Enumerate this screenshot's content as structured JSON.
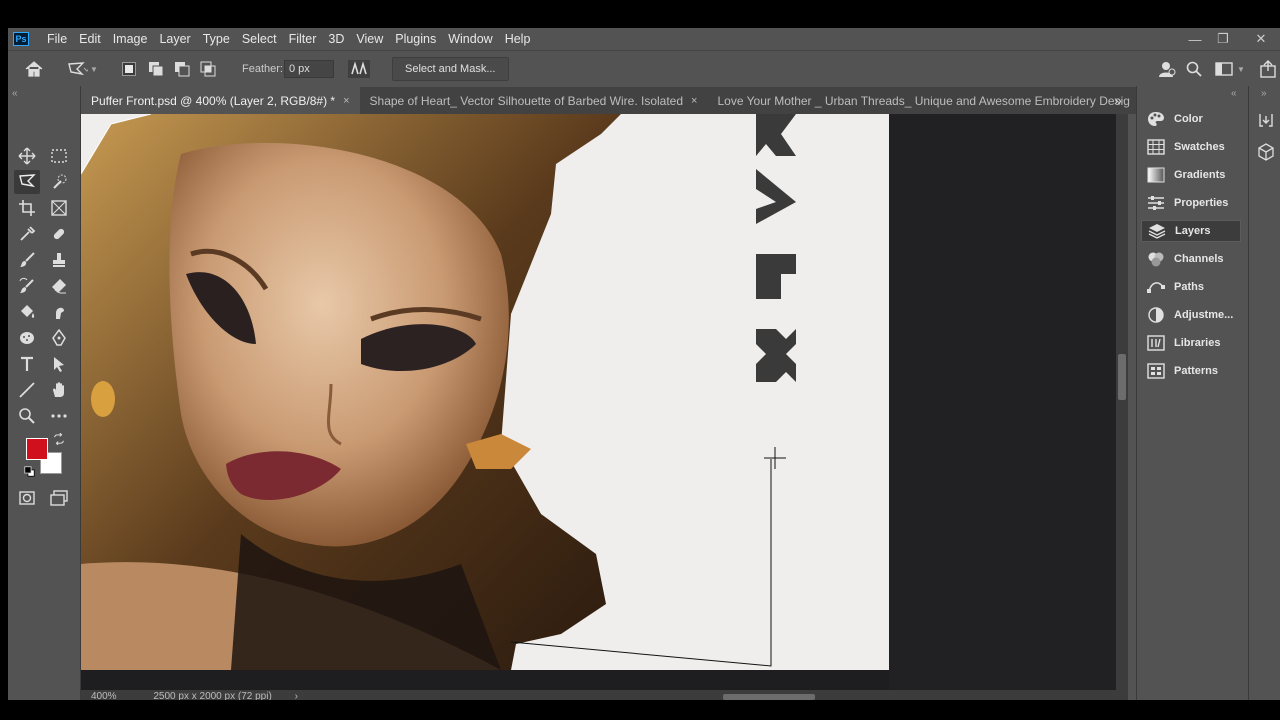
{
  "app": {
    "logo": "Ps"
  },
  "menu": [
    "File",
    "Edit",
    "Image",
    "Layer",
    "Type",
    "Select",
    "Filter",
    "3D",
    "View",
    "Plugins",
    "Window",
    "Help"
  ],
  "window_controls": {
    "minimize": "—",
    "restore": "❐",
    "close": "✕"
  },
  "options": {
    "feather_label": "Feather:",
    "feather_value": "0 px",
    "select_mask_label": "Select and Mask..."
  },
  "tabs": [
    {
      "label": "Puffer Front.psd @ 400% (Layer 2, RGB/8#) *",
      "close": "×"
    },
    {
      "label": "Shape of Heart_ Vector Silhouette of Barbed Wire. Isolated",
      "close": "×"
    },
    {
      "label": "Love Your Mother _ Urban Threads_ Unique and Awesome Embroidery Desig",
      "close": ""
    }
  ],
  "tabs_overflow": "»",
  "colors": {
    "foreground": "#d0101c",
    "background": "#ffffff"
  },
  "panels": [
    {
      "label": "Color",
      "icon": "color-palette-icon"
    },
    {
      "label": "Swatches",
      "icon": "swatches-grid-icon"
    },
    {
      "label": "Gradients",
      "icon": "gradient-icon"
    },
    {
      "label": "Properties",
      "icon": "properties-sliders-icon"
    },
    {
      "label": "Layers",
      "icon": "layers-icon"
    },
    {
      "label": "Channels",
      "icon": "channels-icon"
    },
    {
      "label": "Paths",
      "icon": "paths-icon"
    },
    {
      "label": "Adjustme...",
      "icon": "adjustments-icon"
    },
    {
      "label": "Libraries",
      "icon": "libraries-icon"
    },
    {
      "label": "Patterns",
      "icon": "patterns-icon"
    }
  ],
  "status": {
    "zoom": "400%",
    "doc_size": "2500 px x 2000 px (72 ppi)",
    "arrow": "›"
  }
}
